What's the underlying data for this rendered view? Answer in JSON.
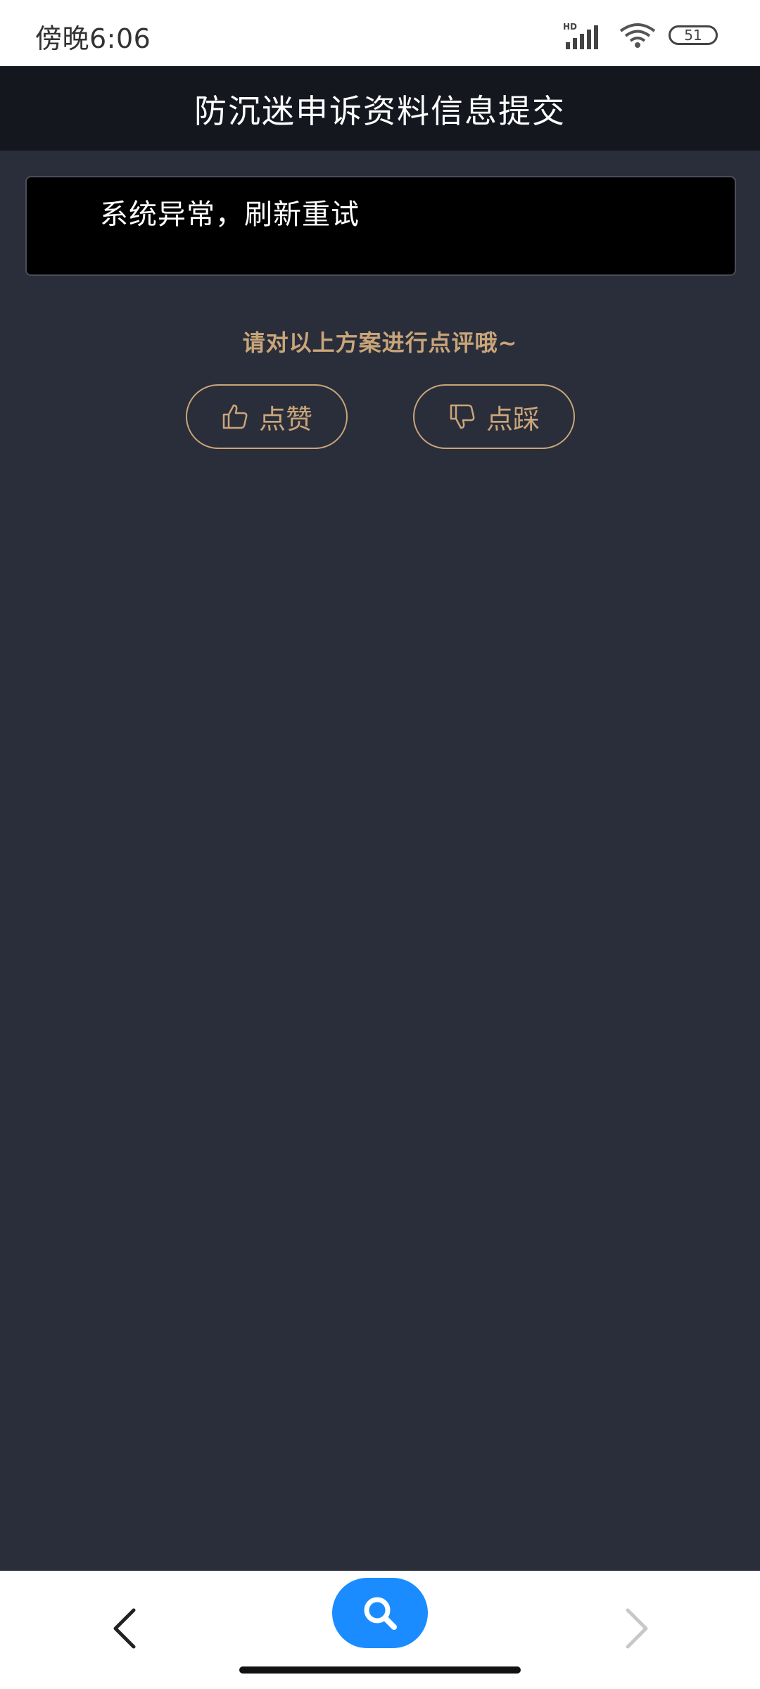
{
  "status_bar": {
    "time": "傍晚6:06",
    "battery": "51",
    "icons": [
      "hd-signal-icon",
      "wifi-icon",
      "battery-icon"
    ]
  },
  "header": {
    "title": "防沉迷申诉资料信息提交"
  },
  "main": {
    "error_message": "系统异常，刷新重试",
    "feedback_prompt": "请对以上方案进行点评哦~",
    "like_label": "点赞",
    "dislike_label": "点踩"
  },
  "bottom_nav": {
    "icons": [
      "back-icon",
      "search-icon",
      "forward-icon"
    ]
  },
  "colors": {
    "background": "#2a2e3a",
    "title_bar": "#15171f",
    "accent_gold": "#c9a57a",
    "search_button": "#1a8cff"
  }
}
